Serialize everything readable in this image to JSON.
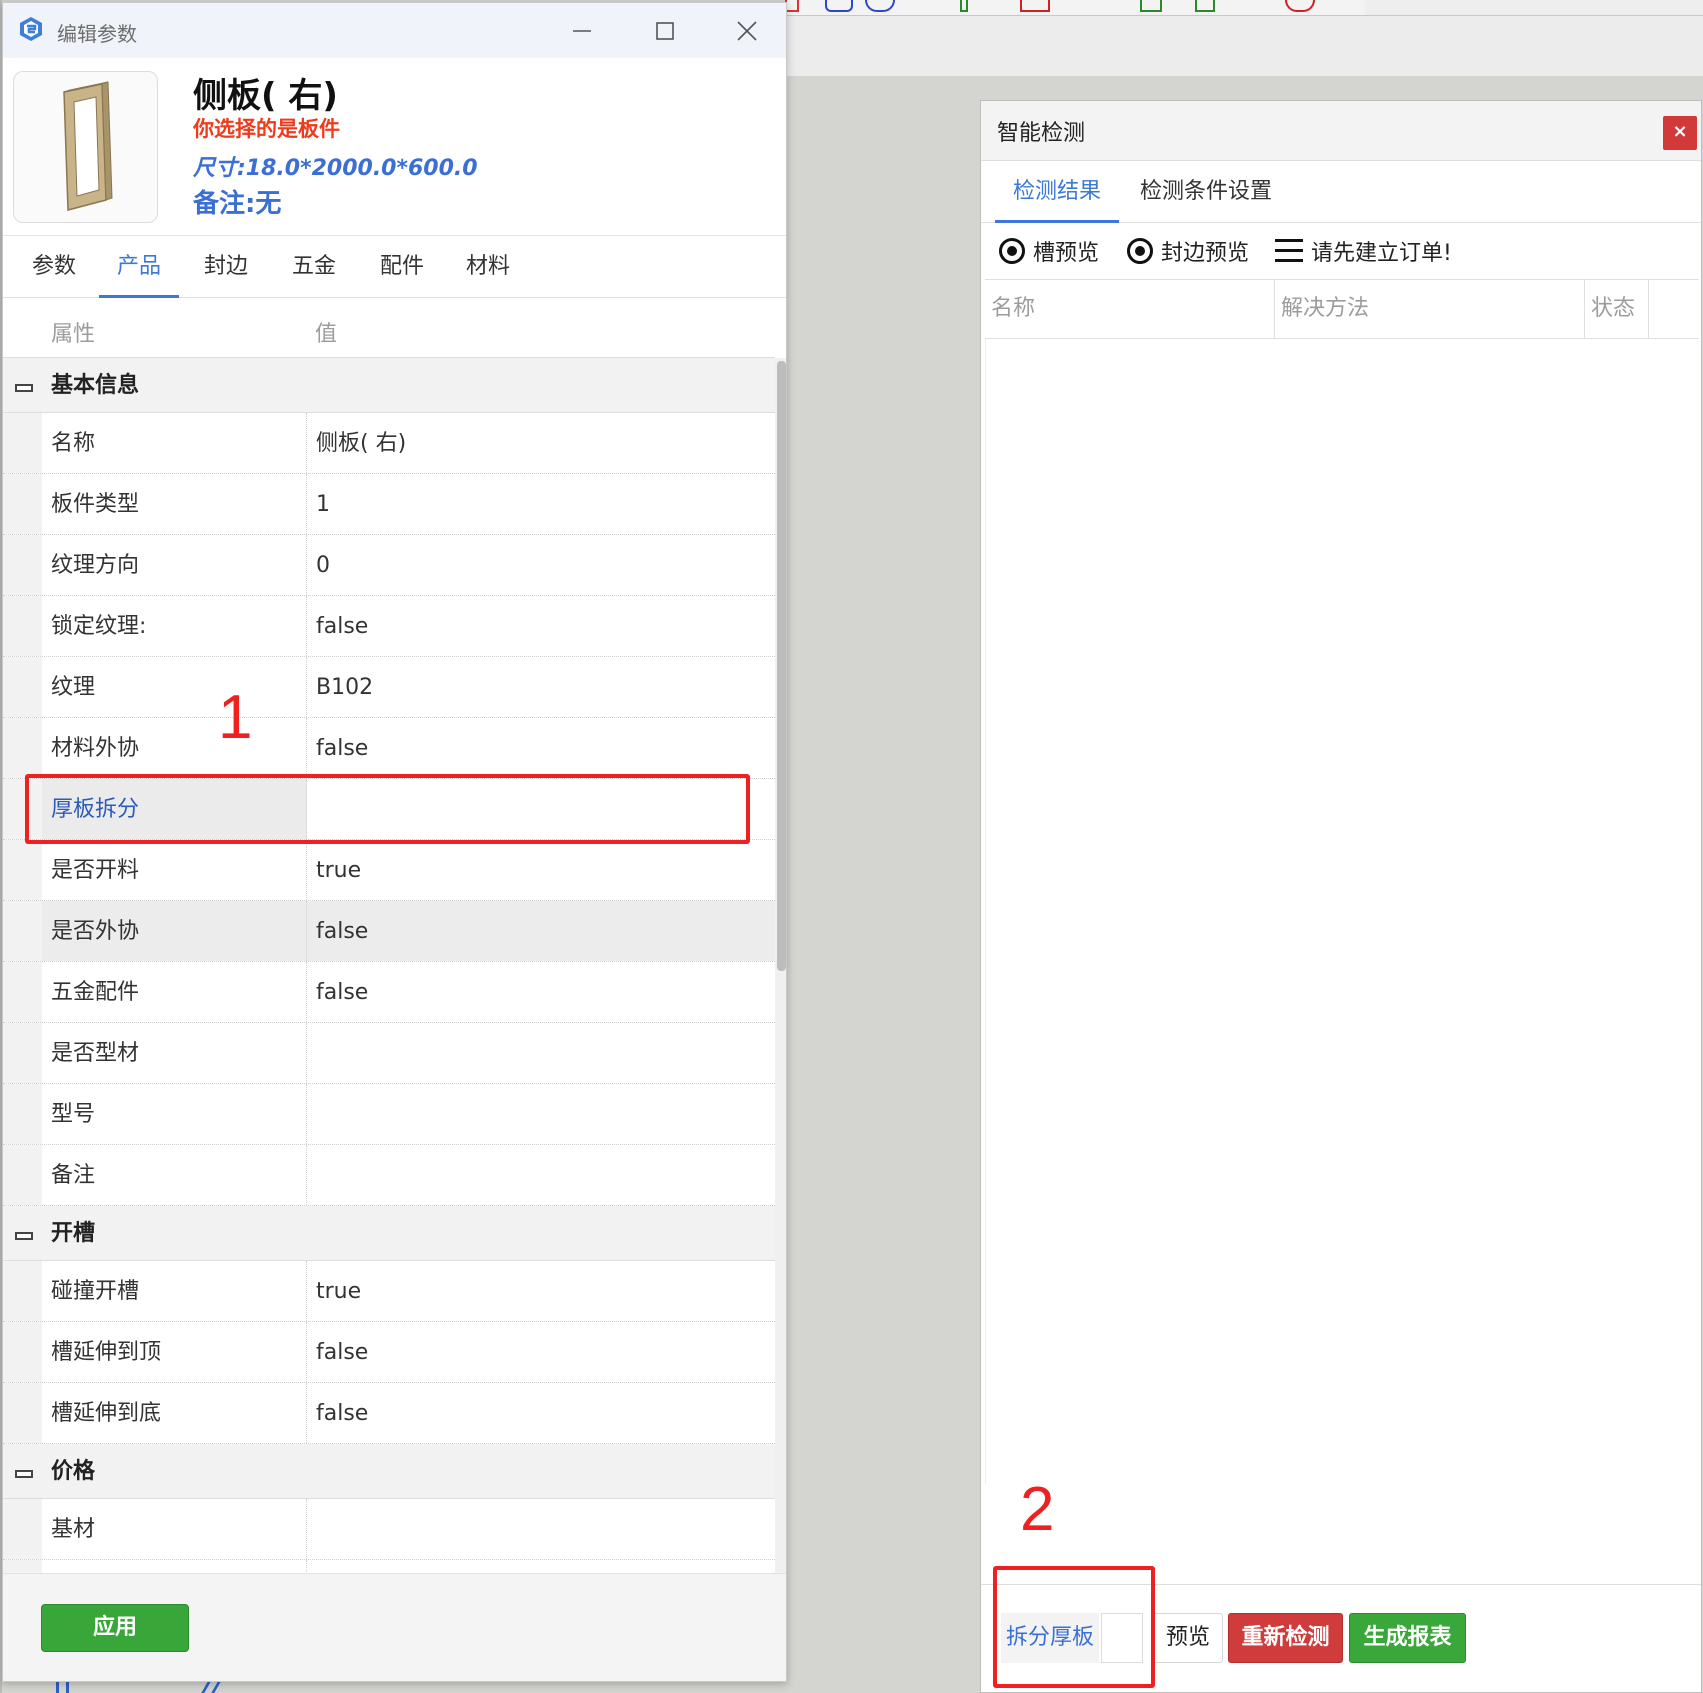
{
  "edit_window": {
    "title": "编辑参数",
    "product_name": "侧板( 右)",
    "selected_text": "你选择的是板件",
    "size_text": "尺寸:18.0*2000.0*600.0",
    "remark_text": "备注:无",
    "tabs": [
      {
        "label": "参数"
      },
      {
        "label": "产品",
        "active": true
      },
      {
        "label": "封边"
      },
      {
        "label": "五金"
      },
      {
        "label": "配件"
      },
      {
        "label": "材料"
      }
    ],
    "grid_header": {
      "property": "属性",
      "value": "值"
    },
    "categories": {
      "basic": "基本信息",
      "grooving": "开槽",
      "price": "价格"
    },
    "rows_basic": [
      {
        "name": "名称",
        "value": "侧板( 右)"
      },
      {
        "name": "板件类型",
        "value": "1"
      },
      {
        "name": "纹理方向",
        "value": "0"
      },
      {
        "name": "锁定纹理:",
        "value": "false"
      },
      {
        "name": "纹理",
        "value": "B102"
      },
      {
        "name": "材料外协",
        "value": "false"
      },
      {
        "name": "厚板拆分",
        "value": ""
      },
      {
        "name": "是否开料",
        "value": "true"
      },
      {
        "name": "是否外协",
        "value": "false"
      },
      {
        "name": "五金配件",
        "value": "false"
      },
      {
        "name": "是否型材",
        "value": ""
      },
      {
        "name": "型号",
        "value": ""
      },
      {
        "name": "备注",
        "value": ""
      }
    ],
    "rows_grooving": [
      {
        "name": "碰撞开槽",
        "value": "true"
      },
      {
        "name": "槽延伸到顶",
        "value": "false"
      },
      {
        "name": "槽延伸到底",
        "value": "false"
      }
    ],
    "rows_price": [
      {
        "name": "基材",
        "value": ""
      }
    ],
    "apply_label": "应用"
  },
  "detect_panel": {
    "title": "智能检测",
    "close_label": "×",
    "tabs": [
      {
        "label": "检测结果",
        "active": true
      },
      {
        "label": "检测条件设置"
      }
    ],
    "toolbar": {
      "groove_preview": "槽预览",
      "edge_preview": "封边预览",
      "order_notice": "请先建立订单!"
    },
    "table_headers": [
      "名称",
      "解决方法",
      "状态"
    ],
    "footer": {
      "split_label": "拆分厚板",
      "split_value": "",
      "preview_label": "预览",
      "redetect_label": "重新检测",
      "report_label": "生成报表"
    }
  },
  "annotations": {
    "num1": "1",
    "num2": "2",
    "color": "#ee2020"
  },
  "colors": {
    "accent": "#3b78d8",
    "warning_text": "#ee3b1b",
    "green_button": "#38a638",
    "red_button": "#d03c3c"
  }
}
